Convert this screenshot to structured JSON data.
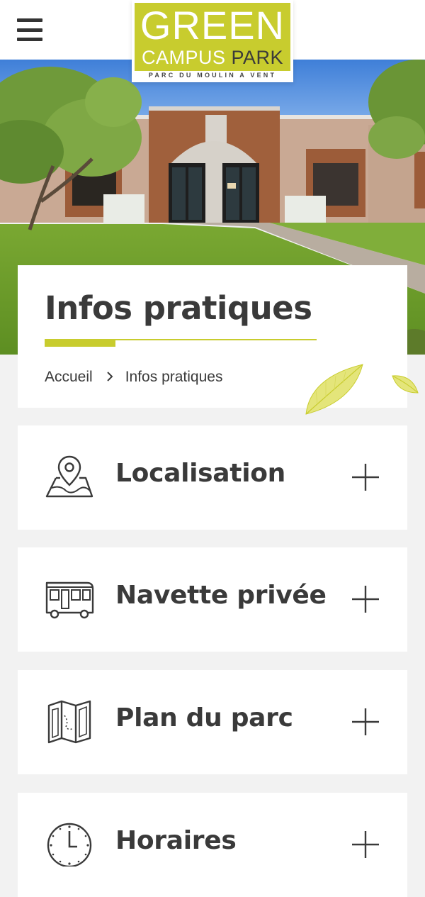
{
  "header": {
    "menu_icon": "hamburger-menu-icon",
    "logo": {
      "line1": "GREEN",
      "line2_part1": "CAMPUS",
      "line2_part2": "PARK",
      "subtitle": "PARC DU MOULIN A VENT",
      "brand_color": "#c8cc2e"
    }
  },
  "hero": {
    "image": "campus-building-photo"
  },
  "page": {
    "title": "Infos pratiques",
    "accent_color": "#c8cc2e",
    "breadcrumb": {
      "home": "Accueil",
      "separator": ">",
      "current": "Infos pratiques"
    }
  },
  "sections": [
    {
      "label": "Localisation",
      "icon": "map-pin-icon"
    },
    {
      "label": "Navette privée",
      "icon": "bus-icon"
    },
    {
      "label": "Plan du parc",
      "icon": "folded-map-icon"
    },
    {
      "label": "Horaires",
      "icon": "clock-icon"
    }
  ],
  "expand_icon": "plus-icon"
}
